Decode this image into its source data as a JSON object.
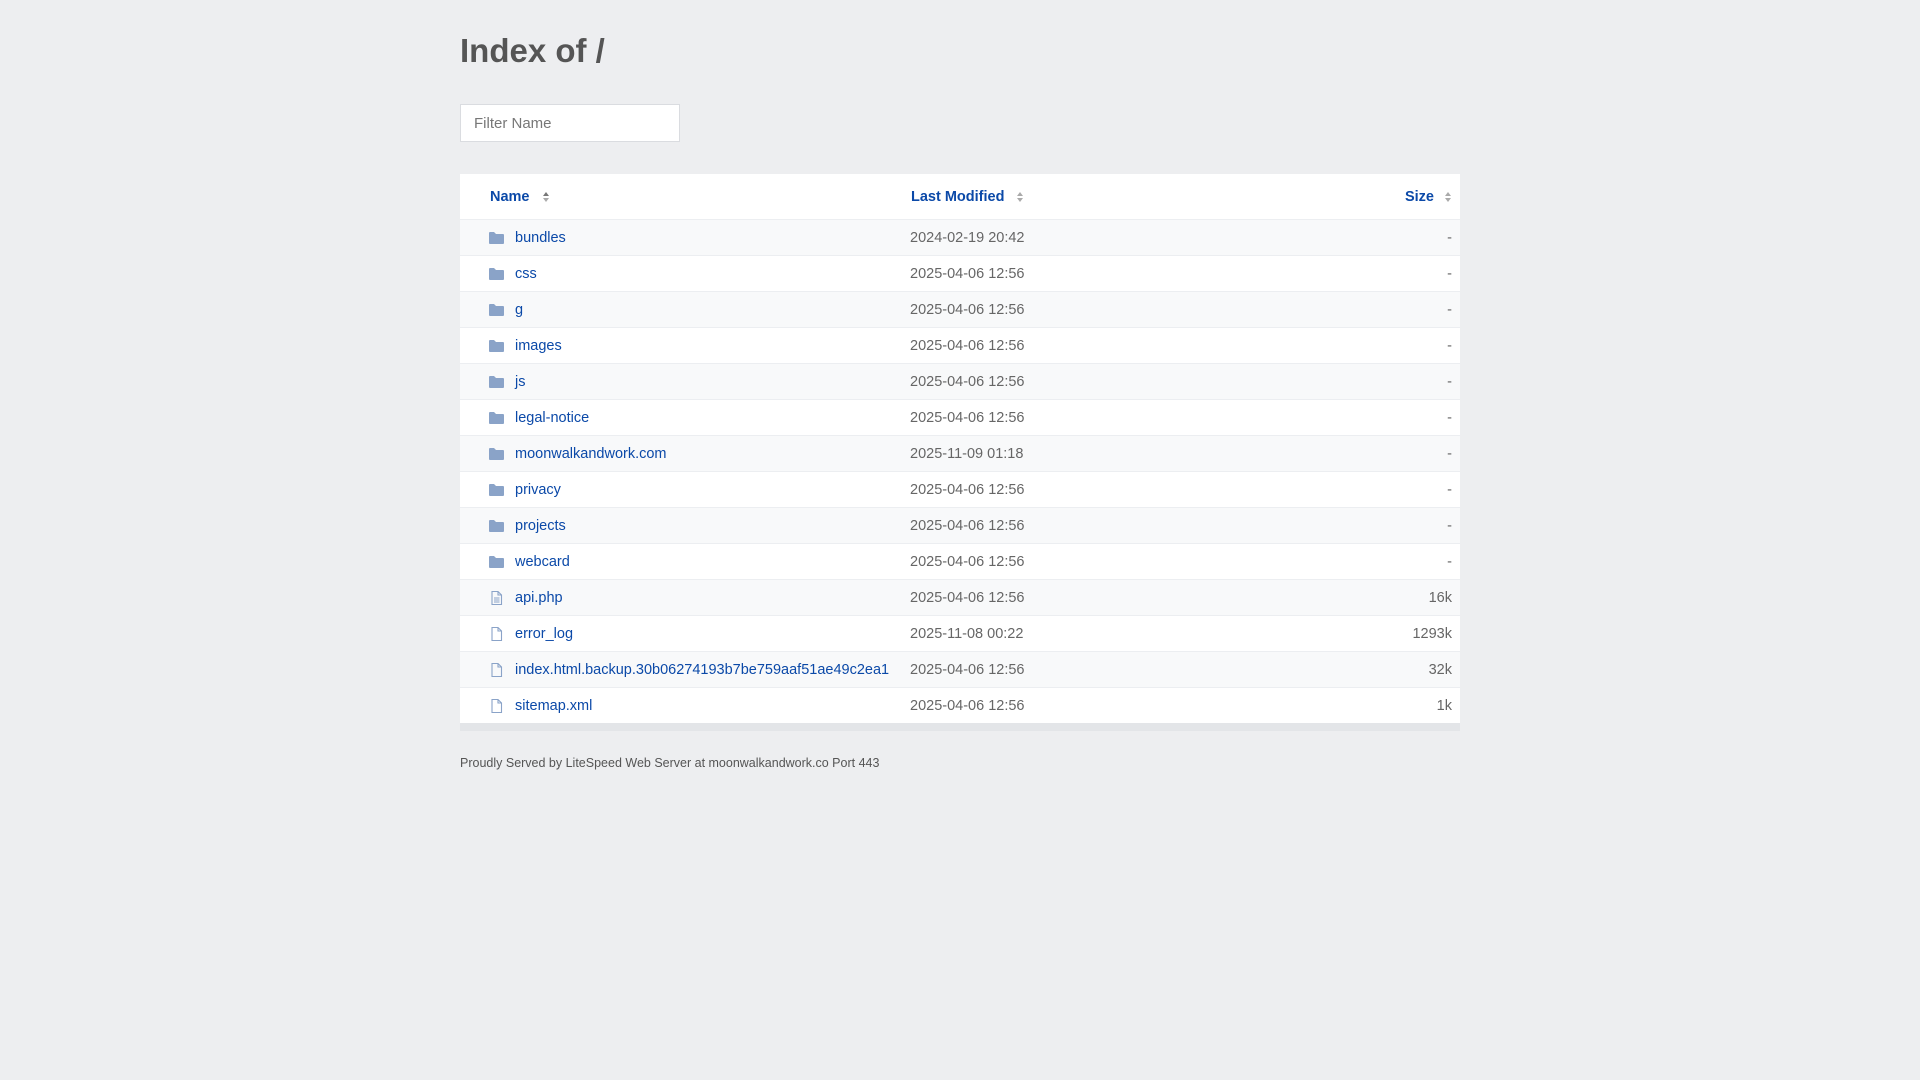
{
  "title": "Index of /",
  "filter": {
    "placeholder": "Filter Name",
    "value": ""
  },
  "columns": {
    "name": "Name",
    "modified": "Last Modified",
    "size": "Size"
  },
  "colors": {
    "link": "#0b49a8",
    "folder": "#8aa3c8",
    "background": "#edeef0"
  },
  "rows": [
    {
      "name": "bundles",
      "modified": "2024-02-19 20:42",
      "size": "-",
      "type": "folder"
    },
    {
      "name": "css",
      "modified": "2025-04-06 12:56",
      "size": "-",
      "type": "folder"
    },
    {
      "name": "g",
      "modified": "2025-04-06 12:56",
      "size": "-",
      "type": "folder"
    },
    {
      "name": "images",
      "modified": "2025-04-06 12:56",
      "size": "-",
      "type": "folder"
    },
    {
      "name": "js",
      "modified": "2025-04-06 12:56",
      "size": "-",
      "type": "folder"
    },
    {
      "name": "legal-notice",
      "modified": "2025-04-06 12:56",
      "size": "-",
      "type": "folder"
    },
    {
      "name": "moonwalkandwork.com",
      "modified": "2025-11-09 01:18",
      "size": "-",
      "type": "folder"
    },
    {
      "name": "privacy",
      "modified": "2025-04-06 12:56",
      "size": "-",
      "type": "folder"
    },
    {
      "name": "projects",
      "modified": "2025-04-06 12:56",
      "size": "-",
      "type": "folder"
    },
    {
      "name": "webcard",
      "modified": "2025-04-06 12:56",
      "size": "-",
      "type": "folder"
    },
    {
      "name": "api.php",
      "modified": "2025-04-06 12:56",
      "size": "16k",
      "type": "text"
    },
    {
      "name": "error_log",
      "modified": "2025-11-08 00:22",
      "size": "1293k",
      "type": "file"
    },
    {
      "name": "index.html.backup.30b06274193b7be759aaf51ae49c2ea1",
      "modified": "2025-04-06 12:56",
      "size": "32k",
      "type": "file"
    },
    {
      "name": "sitemap.xml",
      "modified": "2025-04-06 12:56",
      "size": "1k",
      "type": "file"
    }
  ],
  "footer": "Proudly Served by LiteSpeed Web Server at moonwalkandwork.co Port 443"
}
